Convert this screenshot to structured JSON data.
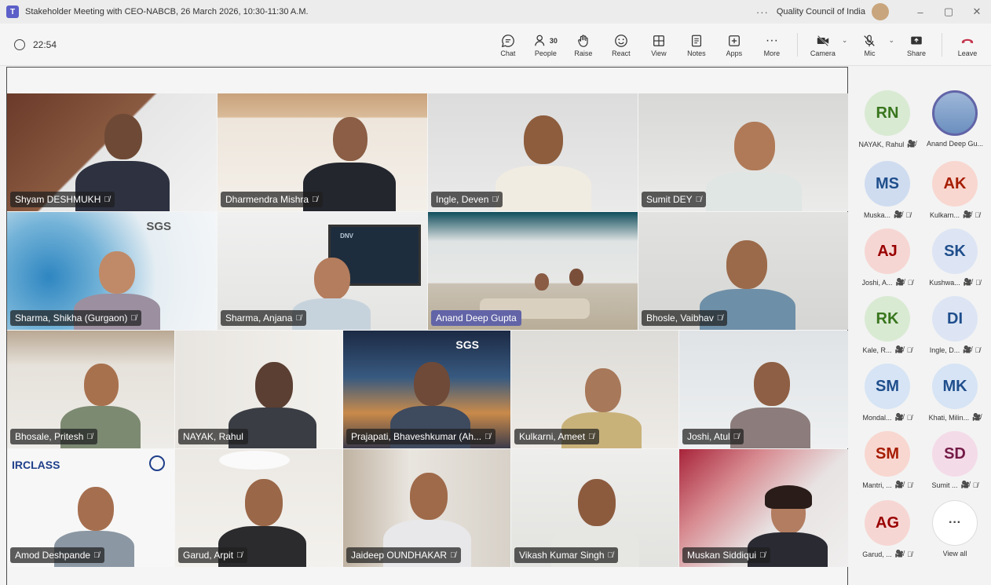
{
  "window": {
    "title": "Stakeholder Meeting with CEO-NABCB, 26 March 2026, 10:30-11:30 A.M.",
    "more": "···",
    "org": "Quality Council of India",
    "minimize": "–",
    "maximize": "▢",
    "close": "✕"
  },
  "toolbar": {
    "timer": "22:54",
    "chat": "Chat",
    "people": "People",
    "people_count": "30",
    "raise": "Raise",
    "react": "React",
    "view": "View",
    "notes": "Notes",
    "apps": "Apps",
    "more": "More",
    "camera": "Camera",
    "mic": "Mic",
    "share": "Share",
    "leave": "Leave"
  },
  "tiles": [
    {
      "name": "Shyam DESHMUKH",
      "muted": true
    },
    {
      "name": "Dharmendra Mishra",
      "muted": true
    },
    {
      "name": "Ingle, Deven",
      "muted": true
    },
    {
      "name": "Sumit DEY",
      "muted": true
    },
    {
      "name": "Sharma, Shikha (Gurgaon)",
      "muted": true,
      "brand": "SGS"
    },
    {
      "name": "Sharma, Anjana",
      "muted": true,
      "brand": "DNV"
    },
    {
      "name": "Anand Deep Gupta",
      "muted": false,
      "active": true
    },
    {
      "name": "Bhosle, Vaibhav",
      "muted": true
    },
    {
      "name": "Bhosale, Pritesh",
      "muted": true
    },
    {
      "name": "NAYAK, Rahul",
      "muted": false
    },
    {
      "name": "Prajapati, Bhaveshkumar (Ah...",
      "muted": true,
      "brand": "SGS"
    },
    {
      "name": "Kulkarni, Ameet",
      "muted": true
    },
    {
      "name": "Joshi, Atul",
      "muted": true
    },
    {
      "name": "Amod Deshpande",
      "muted": true,
      "brand": "IRCLASS"
    },
    {
      "name": "Garud, Arpit",
      "muted": true
    },
    {
      "name": "Jaideep OUNDHAKAR",
      "muted": true
    },
    {
      "name": "Vikash Kumar Singh",
      "muted": true
    },
    {
      "name": "Muskan Siddiqui",
      "muted": true
    }
  ],
  "roster": [
    {
      "initials": "RN",
      "label": "NAYAK, Rahul",
      "color": "#d9ead3",
      "fg": "#38761d"
    },
    {
      "initials": "",
      "label": "Anand Deep Gu...",
      "color": "#9fb7d8",
      "fg": "#ffffff"
    },
    {
      "initials": "MS",
      "label": "Muska...",
      "color": "#cfdcf0",
      "fg": "#1f4e8c"
    },
    {
      "initials": "AK",
      "label": "Kulkarn...",
      "color": "#f8d7d0",
      "fg": "#a61c00"
    },
    {
      "initials": "AJ",
      "label": "Joshi, A...",
      "color": "#f6d6d3",
      "fg": "#990000"
    },
    {
      "initials": "SK",
      "label": "Kushwa...",
      "color": "#dde5f4",
      "fg": "#1f4e8c"
    },
    {
      "initials": "RK",
      "label": "Kale, R...",
      "color": "#d9ead3",
      "fg": "#38761d"
    },
    {
      "initials": "DI",
      "label": "Ingle, D...",
      "color": "#dde5f4",
      "fg": "#1f4e8c"
    },
    {
      "initials": "SM",
      "label": "Mondal...",
      "color": "#d6e4f5",
      "fg": "#1f4e8c"
    },
    {
      "initials": "MK",
      "label": "Khati, Milin...",
      "color": "#d6e4f5",
      "fg": "#1f4e8c"
    },
    {
      "initials": "SM",
      "label": "Mantri, ...",
      "color": "#f8d7d0",
      "fg": "#a61c00"
    },
    {
      "initials": "SD",
      "label": "Sumit ...",
      "color": "#f4dbe8",
      "fg": "#741b47"
    },
    {
      "initials": "AG",
      "label": "Garud, ...",
      "color": "#f6d6d3",
      "fg": "#990000"
    },
    {
      "initials": "···",
      "label": "View all",
      "color": "#ffffff",
      "fg": "#444444"
    }
  ]
}
